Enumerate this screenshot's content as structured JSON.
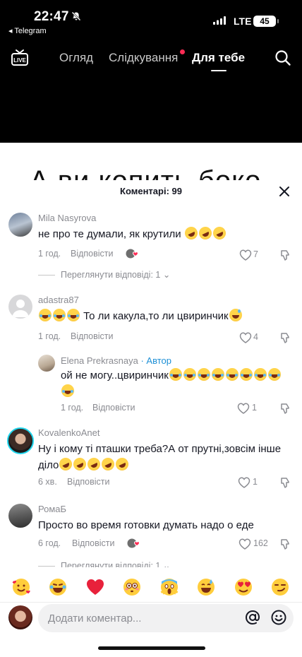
{
  "status_bar": {
    "time": "22:47",
    "back_app": "◂ Telegram",
    "network": "LTE",
    "battery": "45"
  },
  "nav": {
    "tabs": [
      {
        "label": "Огляд"
      },
      {
        "label": "Слідкування"
      },
      {
        "label": "Для тебе"
      }
    ],
    "live_label": "LIVE"
  },
  "video": {
    "caption_peek": "А ви копить боко"
  },
  "comments_panel": {
    "title": "Коментарі: 99",
    "comments": [
      {
        "user": "Mila Nasyrova",
        "text": "не про те думали, як крутили",
        "time": "1 год.",
        "reply": "Відповісти",
        "likes": "7",
        "view_replies": "Переглянути відповіді: 1"
      },
      {
        "user": "adastra87",
        "text": "То ли какула,то ли цвиринчик",
        "time": "1 год.",
        "reply": "Відповісти",
        "likes": "4"
      },
      {
        "user": "Elena Prekrasnaya",
        "author_badge": "· Автор",
        "text": "ой не могу..цвиринчик",
        "time": "1 год.",
        "reply": "Відповісти",
        "likes": "1"
      },
      {
        "user": "KovalenkoAnet",
        "text_line1": "Ну і кому ті пташки треба?А от прутні,зовсім інше",
        "text_line2": "діло",
        "time": "6 хв.",
        "reply": "Відповісти",
        "likes": "1"
      },
      {
        "user": "РомаБ",
        "text": "Просто во время готовки думать надо о еде",
        "time": "6 год.",
        "reply": "Відповісти",
        "likes": "162",
        "view_replies": "Переглянути відповіді: 1"
      }
    ],
    "reactions": [
      "smiling-face-with-hearts",
      "face-with-tears-of-joy",
      "red-heart",
      "flushed-face",
      "screaming-face",
      "grinning-face-with-sweat",
      "heart-eyes-face",
      "smirking-face"
    ],
    "input_placeholder": "Додати коментар..."
  }
}
